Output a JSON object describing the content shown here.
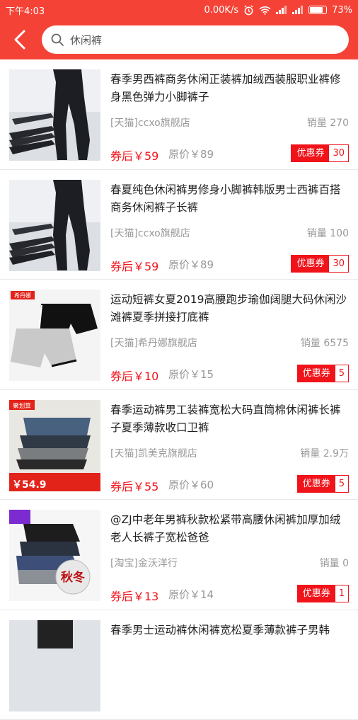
{
  "status": {
    "time": "下午4:03",
    "speed": "0.00K/s",
    "battery": "73%",
    "battery_level": 0.73
  },
  "search": {
    "query": "休闲裤"
  },
  "products": [
    {
      "title": "春季男西裤商务休闲正装裤加绒西装服职业裤修身黑色弹力小脚裤子",
      "shop": "[天猫]ccxo旗舰店",
      "sales": "销量 270",
      "after_price": "券后￥59",
      "orig_price": "原价￥89",
      "coupon_label": "优惠券",
      "coupon_value": "30",
      "image": "black-pants"
    },
    {
      "title": "春夏纯色休闲裤男修身小脚裤韩版男士西裤百搭商务休闲裤子长裤",
      "shop": "[天猫]ccxo旗舰店",
      "sales": "销量 100",
      "after_price": "券后￥59",
      "orig_price": "原价￥89",
      "coupon_label": "优惠券",
      "coupon_value": "30",
      "image": "black-pants"
    },
    {
      "title": "运动短裤女夏2019高腰跑步瑜伽阔腿大码休闲沙滩裤夏季拼接打底裤",
      "shop": "[天猫]希丹娜旗舰店",
      "sales": "销量 6575",
      "after_price": "券后￥10",
      "orig_price": "原价￥15",
      "coupon_label": "优惠券",
      "coupon_value": "5",
      "image": "shorts",
      "image_brand": "希丹娜"
    },
    {
      "title": "春季运动裤男工装裤宽松大码直筒棉休闲裤长裤子夏季薄款收口卫裤",
      "shop": "[天猫]凯美克旗舰店",
      "sales": "销量 2.9万",
      "after_price": "券后￥55",
      "orig_price": "原价￥60",
      "coupon_label": "优惠券",
      "coupon_value": "5",
      "image": "stacked-pants",
      "image_badge": "聚划算",
      "image_price": "54.9"
    },
    {
      "title": "@ZJ中老年男裤秋款松紧带高腰休闲裤加厚加绒老人长裤子宽松爸爸",
      "shop": "[淘宝]金沃洋行",
      "sales": "销量 0",
      "after_price": "券后￥13",
      "orig_price": "原价￥14",
      "coupon_label": "优惠券",
      "coupon_value": "1",
      "image": "folded-pants",
      "image_stamp": "秋冬"
    },
    {
      "title": "春季男士运动裤休闲裤宽松夏季薄款裤子男韩",
      "image": "partial"
    }
  ]
}
